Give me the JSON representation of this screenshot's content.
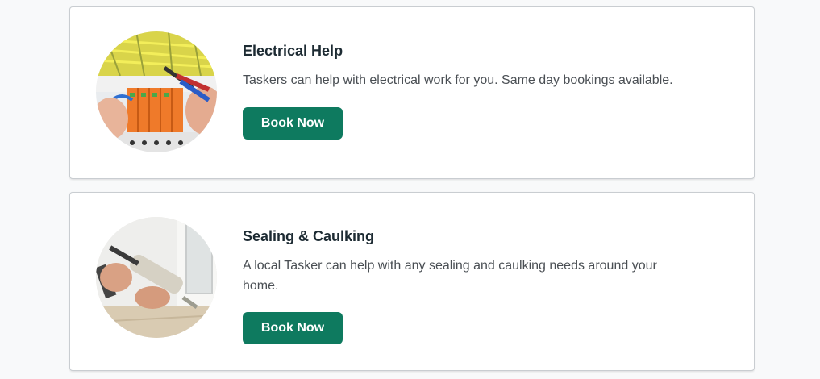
{
  "colors": {
    "page_bg": "#f8f9fa",
    "card_bg": "#ffffff",
    "button_bg": "#0e7a5f",
    "button_text": "#ffffff",
    "title": "#1d2b33",
    "body_text": "#4a4f54"
  },
  "services": [
    {
      "title": "Electrical Help",
      "description": "Taskers can help with electrical work for you. Same day bookings available.",
      "button_label": "Book Now",
      "image": "electrical-work-photo"
    },
    {
      "title": "Sealing & Caulking",
      "description": "A local Tasker can help with any sealing and caulking needs around your home.",
      "button_label": "Book Now",
      "image": "caulking-gun-photo"
    }
  ]
}
